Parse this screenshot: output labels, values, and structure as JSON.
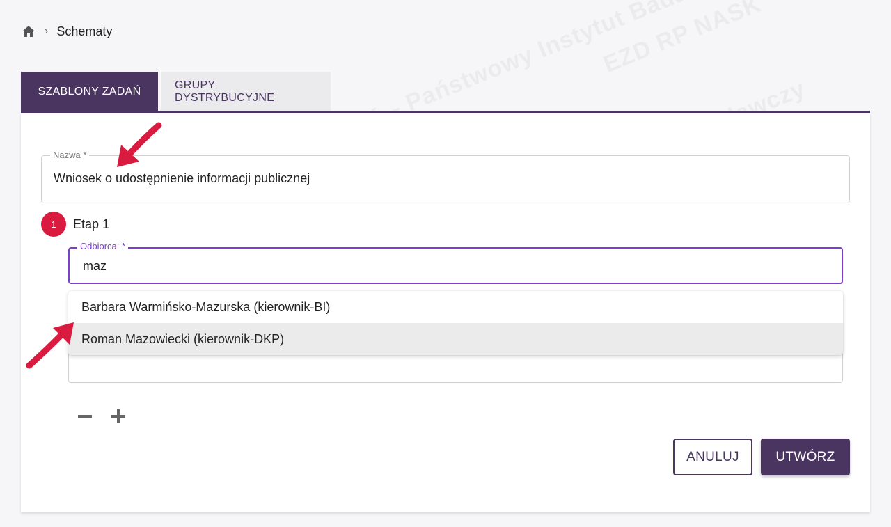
{
  "breadcrumb": {
    "home_icon": "home-icon",
    "current": "Schematy"
  },
  "tabs": [
    {
      "label": "SZABLONY ZADAŃ",
      "active": true
    },
    {
      "label": "GRUPY DYSTRYBUCYJNE",
      "active": false
    }
  ],
  "form": {
    "name": {
      "label": "Nazwa *",
      "value": "Wniosek o udostępnienie informacji publicznej"
    },
    "step": {
      "number": "1",
      "label": "Etap 1"
    },
    "recipient": {
      "label": "Odbiorca: *",
      "value": "maz"
    },
    "suggestions": [
      {
        "label": "Barbara Warmińsko-Mazurska (kierownik-BI)",
        "highlighted": false
      },
      {
        "label": "Roman Mazowiecki (kierownik-DKP)",
        "highlighted": true
      }
    ],
    "stepper": {
      "minus_icon": "minus-icon",
      "plus_icon": "plus-icon"
    }
  },
  "actions": {
    "cancel_label": "ANULUJ",
    "create_label": "UTWÓRZ"
  },
  "watermark": {
    "texts": [
      "NASK – Państwowy Instytut Badawczy",
      "EZD RP NASK"
    ]
  },
  "colors": {
    "primary": "#4a3560",
    "step_badge": "#d81b3f",
    "focus": "#7d3ec8",
    "arrow": "#d81b3f"
  }
}
